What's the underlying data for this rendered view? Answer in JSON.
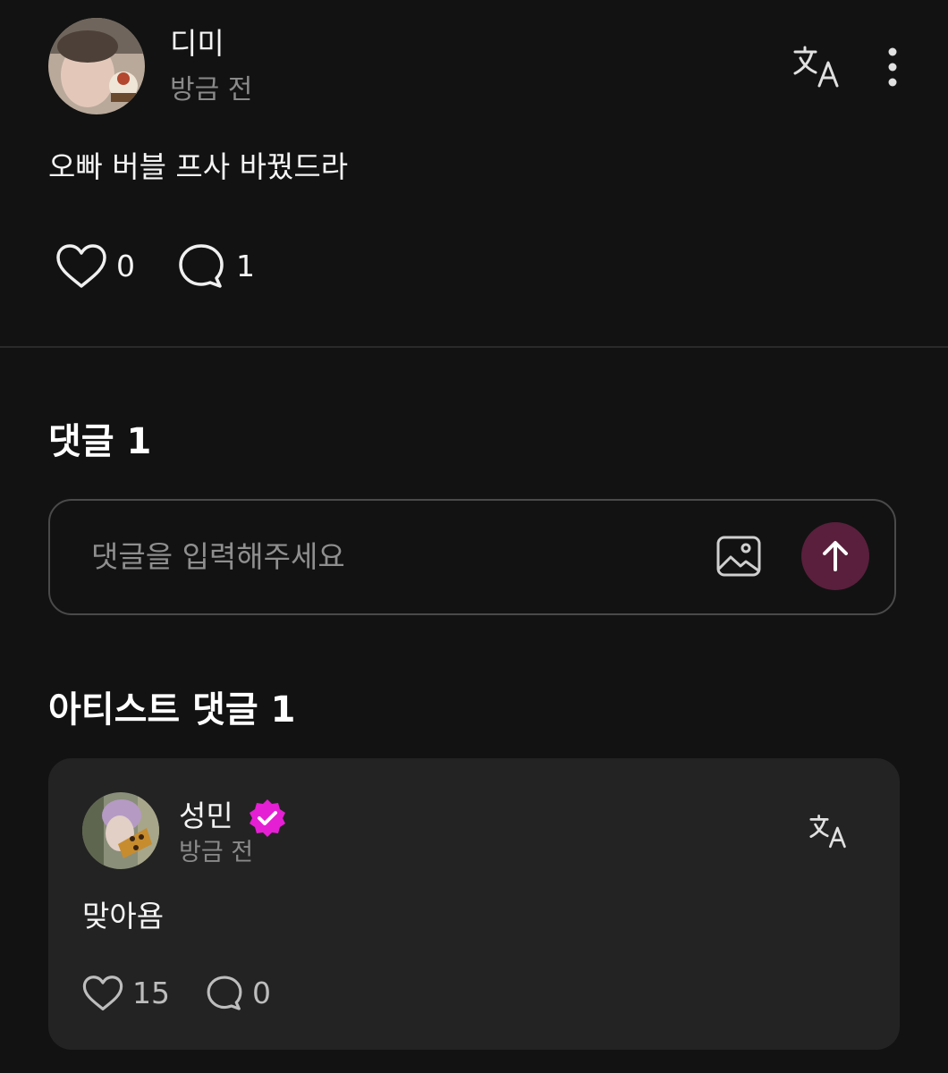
{
  "post": {
    "username": "디미",
    "timestamp": "방금 전",
    "text": "오빠 버블 프사 바꿨드라",
    "likes": "0",
    "comments": "1",
    "icons": {
      "translate": "translate-icon",
      "more": "more-vertical-icon",
      "like": "heart-icon",
      "comment": "comment-bubble-icon"
    }
  },
  "comments_section": {
    "title": "댓글 1",
    "input_placeholder": "댓글을 입력해주세요",
    "icons": {
      "image": "image-icon",
      "send": "arrow-up-icon"
    },
    "send_button_color": "#5a1f3c"
  },
  "artist_comments": {
    "title": "아티스트 댓글 1",
    "items": [
      {
        "name": "성민",
        "verified": true,
        "verified_badge_color": "#e51fd4",
        "timestamp": "방금 전",
        "text": "맞아욤",
        "likes": "15",
        "replies": "0"
      }
    ]
  },
  "colors": {
    "background": "#121212",
    "card": "#232323",
    "text": "#f4f4f4",
    "muted": "#8a8a8a"
  }
}
